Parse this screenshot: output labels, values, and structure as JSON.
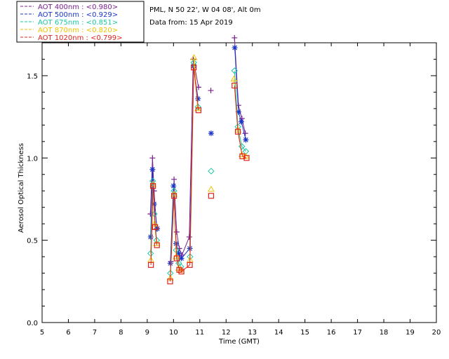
{
  "info": {
    "location": "PML, N 50 22', W 04 08', Alt 0m",
    "date": "Data from: 15 Apr 2019"
  },
  "legend": [
    {
      "label": "AOT  400nm : <0.980>",
      "color": "#7a1f8f"
    },
    {
      "label": "AOT  500nm : <0.929>",
      "color": "#1a35c7"
    },
    {
      "label": "AOT  675nm : <0.851>",
      "color": "#18c8a4"
    },
    {
      "label": "AOT  870nm : <0.820>",
      "color": "#f0c000"
    },
    {
      "label": "AOT 1020nm : <0.799>",
      "color": "#e0241b"
    }
  ],
  "chart_data": {
    "type": "scatter",
    "title": "",
    "xlabel": "Time (GMT)",
    "ylabel": "Aerosol Optical Thickness",
    "xlim": [
      5,
      20
    ],
    "ylim": [
      0.0,
      1.7
    ],
    "xticks": [
      "5",
      "6",
      "7",
      "8",
      "9",
      "10",
      "11",
      "12",
      "13",
      "14",
      "15",
      "16",
      "17",
      "18",
      "19",
      "20"
    ],
    "yticks": [
      "0.0",
      "0.5",
      "1.0",
      "1.5"
    ],
    "series": [
      {
        "name": "AOT  400nm",
        "color": "#7a1f8f",
        "marker": "plus",
        "points": [
          [
            9.12,
            0.66
          ],
          [
            9.2,
            1.0
          ],
          [
            9.26,
            0.8
          ],
          [
            9.36,
            0.57
          ],
          [
            9.9,
            0.37
          ],
          [
            10.02,
            0.87
          ],
          [
            10.12,
            0.55
          ],
          [
            10.22,
            0.45
          ],
          [
            10.32,
            0.41
          ],
          [
            10.6,
            0.52
          ],
          [
            10.75,
            1.6
          ],
          [
            10.95,
            1.43
          ],
          [
            11.42,
            1.41
          ],
          [
            12.32,
            1.73
          ],
          [
            12.47,
            1.32
          ],
          [
            12.6,
            1.24
          ],
          [
            12.73,
            1.15
          ]
        ]
      },
      {
        "name": "AOT  500nm",
        "color": "#1a35c7",
        "marker": "star",
        "points": [
          [
            9.13,
            0.52
          ],
          [
            9.2,
            0.93
          ],
          [
            9.26,
            0.72
          ],
          [
            9.38,
            0.57
          ],
          [
            9.88,
            0.36
          ],
          [
            10.0,
            0.83
          ],
          [
            10.1,
            0.48
          ],
          [
            10.2,
            0.42
          ],
          [
            10.3,
            0.39
          ],
          [
            10.62,
            0.45
          ],
          [
            10.77,
            1.56
          ],
          [
            10.93,
            1.36
          ],
          [
            11.43,
            1.15
          ],
          [
            12.33,
            1.67
          ],
          [
            12.47,
            1.28
          ],
          [
            12.58,
            1.22
          ],
          [
            12.75,
            1.11
          ]
        ]
      },
      {
        "name": "AOT  675nm",
        "color": "#18c8a4",
        "marker": "diamond",
        "points": [
          [
            9.13,
            0.42
          ],
          [
            9.21,
            0.86
          ],
          [
            9.27,
            0.66
          ],
          [
            9.36,
            0.5
          ],
          [
            9.88,
            0.3
          ],
          [
            10.02,
            0.8
          ],
          [
            10.1,
            0.44
          ],
          [
            10.2,
            0.36
          ],
          [
            10.28,
            0.34
          ],
          [
            10.63,
            0.4
          ],
          [
            10.77,
            1.58
          ],
          [
            10.93,
            1.31
          ],
          [
            11.43,
            0.92
          ],
          [
            12.32,
            1.53
          ],
          [
            12.45,
            1.19
          ],
          [
            12.6,
            1.07
          ],
          [
            12.75,
            1.04
          ]
        ]
      },
      {
        "name": "AOT  870nm",
        "color": "#f0c000",
        "marker": "triangle",
        "points": [
          [
            9.14,
            0.38
          ],
          [
            9.22,
            0.84
          ],
          [
            9.28,
            0.6
          ],
          [
            9.36,
            0.48
          ],
          [
            9.88,
            0.27
          ],
          [
            10.02,
            0.78
          ],
          [
            10.1,
            0.4
          ],
          [
            10.2,
            0.33
          ],
          [
            10.28,
            0.32
          ],
          [
            10.63,
            0.38
          ],
          [
            10.78,
            1.61
          ],
          [
            10.92,
            1.3
          ],
          [
            11.43,
            0.81
          ],
          [
            12.3,
            1.48
          ],
          [
            12.45,
            1.17
          ],
          [
            12.6,
            1.02
          ],
          [
            12.75,
            1.01
          ]
        ]
      },
      {
        "name": "AOT 1020nm",
        "color": "#e0241b",
        "marker": "square",
        "points": [
          [
            9.14,
            0.35
          ],
          [
            9.22,
            0.83
          ],
          [
            9.3,
            0.58
          ],
          [
            9.37,
            0.47
          ],
          [
            9.87,
            0.25
          ],
          [
            10.02,
            0.77
          ],
          [
            10.12,
            0.39
          ],
          [
            10.22,
            0.32
          ],
          [
            10.3,
            0.31
          ],
          [
            10.62,
            0.35
          ],
          [
            10.77,
            1.55
          ],
          [
            10.95,
            1.29
          ],
          [
            11.43,
            0.77
          ],
          [
            12.32,
            1.44
          ],
          [
            12.45,
            1.16
          ],
          [
            12.62,
            1.01
          ],
          [
            12.78,
            1.0
          ]
        ]
      }
    ]
  }
}
